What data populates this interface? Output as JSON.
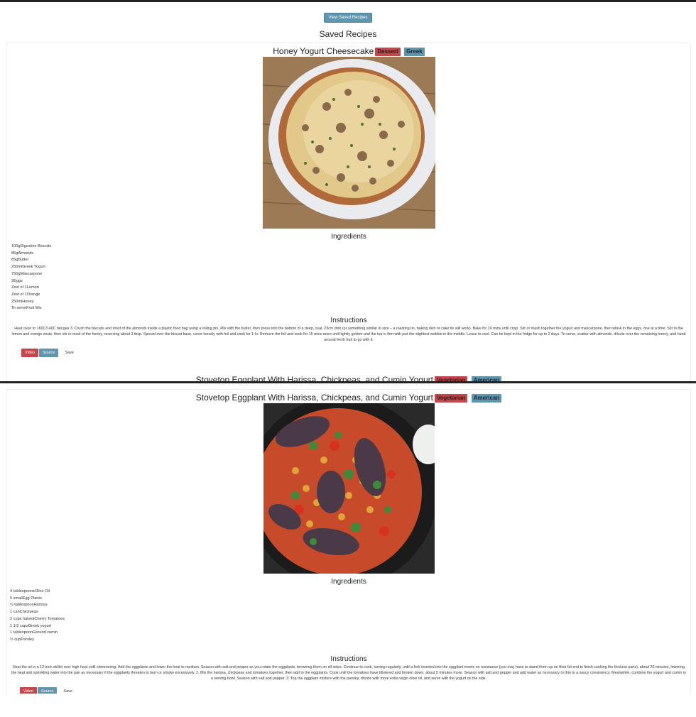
{
  "header": {
    "view_saved_label": "View Saved Recipes",
    "page_title": "Saved Recipes"
  },
  "recipes": [
    {
      "title": "Honey Yogurt Cheesecake",
      "tags": [
        "Dessert",
        "Greek"
      ],
      "ingredients_heading": "Ingredients",
      "ingredients": [
        "100gDigestive Biscuits",
        "85gAlmonds",
        "85gButter",
        "250mlGreek Yogurt",
        "750gMascarpone",
        "2Eggs",
        "Zest of 1Lemon",
        "Zest of 1Orange",
        "250mlHoney",
        "To serveFruit Mix"
      ],
      "instructions_heading": "Instructions",
      "instructions": "Heat oven to 160C/140C fan/gas 3. Crush the biscuits and most of the almonds inside a plastic food bag using a rolling pin. Mix with the butter, then press into the bottom of a deep, oval, 23cm dish (or something similar in size – a roasting tin, baking dish or cake tin will work). Bake for 10 mins until crisp. Stir or mash together the yogurt and mascarpone, then whisk in the eggs, one at a time. Stir in the lemon and orange zests, then stir in most of the honey, reserving about 3 tbsp. Spread over the biscuit base, cover loosely with foil and cook for 1 hr. Remove the foil and cook for 15 mins more until lightly golden and the top is firm with just the slightest wobble in the middle. Leave to cool. Can be kept in the fridge for up to 2 days. To serve, scatter with almonds, drizzle over the remaining honey, and hand around fresh fruit to go with it.",
      "buttons": {
        "video": "Video",
        "source": "Source",
        "save": "Save"
      }
    },
    {
      "title": "Stovetop Eggplant With Harissa, Chickpeas, and Cumin Yogurt",
      "tags": [
        "Vegetarian",
        "American"
      ],
      "ingredients_heading": "Ingredients",
      "ingredients": [
        "4 tablespoonsOlive Oil",
        "6 smallEgg Plants",
        "½ tablespoonHarissa",
        "1 canChickpeas",
        "2 cups halvedCherry Tomatoes",
        "1 1/2 cupsGreek yogurt",
        "1 tablespoonGround cumin",
        "½ cupParsley"
      ],
      "instructions_heading": "Instructions",
      "instructions": "Heat the oil in a 12-inch skillet over high heat until shimmering. Add the eggplants and lower the heat to medium. Season with salt and pepper as you rotate the eggplants, browning them on all sides. Continue to cook, turning regularly, until a fork inserted into the eggplant meets no resistance (you may have to stand them up on their fat end to finish cooking the thickest parts), about 20 minutes, lowering the heat and sprinkling water into the pan as necessary if the eggplants threaten to burn or smoke excessively. 2. Mix the harissa, chickpeas and tomatoes together, then add to the eggplants. Cook until the tomatoes have blistered and broken down, about 5 minutes more. Season with salt and pepper and add water as necessary to thin to a saucy consistency. Meanwhile, combine the yogurt and cumin in a serving bowl. Season with salt and pepper. 3. Top the eggplant mixture with the parsley, drizzle with more extra virgin olive oil, and serve with the yogurt on the side.",
      "buttons": {
        "video": "Video",
        "source": "Source",
        "save": "Save"
      }
    }
  ]
}
